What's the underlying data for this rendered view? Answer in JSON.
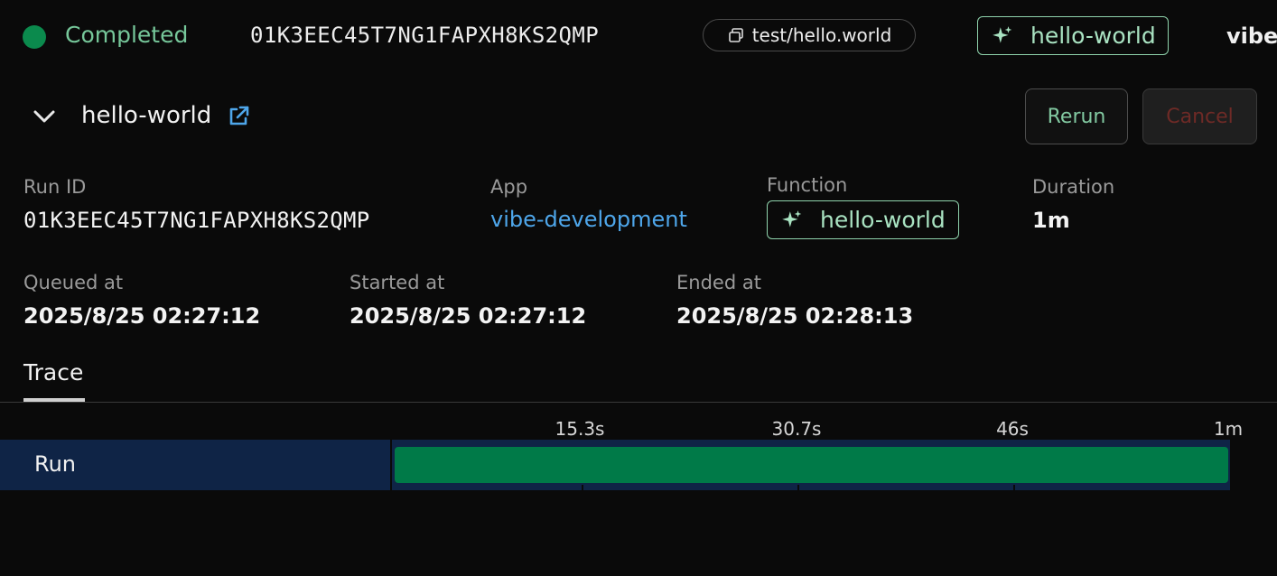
{
  "top": {
    "status": "Completed",
    "run_id": "01K3EEC45T7NG1FAPXH8KS2QMP",
    "event_name": "test/hello.world",
    "function_name": "hello-world",
    "app_truncated": "vibe"
  },
  "header": {
    "title": "hello-world",
    "rerun_label": "Rerun",
    "cancel_label": "Cancel"
  },
  "meta": {
    "run_id_label": "Run ID",
    "run_id": "01K3EEC45T7NG1FAPXH8KS2QMP",
    "app_label": "App",
    "app": "vibe-development",
    "function_label": "Function",
    "function": "hello-world",
    "duration_label": "Duration",
    "duration": "1m",
    "queued_label": "Queued at",
    "queued": "2025/8/25 02:27:12",
    "started_label": "Started at",
    "started": "2025/8/25 02:27:12",
    "ended_label": "Ended at",
    "ended": "2025/8/25 02:28:13"
  },
  "tabs": {
    "trace": "Trace"
  },
  "timeline": {
    "ticks": [
      "15.3s",
      "30.7s",
      "46s",
      "1m"
    ],
    "row_label": "Run",
    "run_progress": 1.0
  },
  "colors": {
    "status_green": "#0b8a4d",
    "run_bar": "#007a48",
    "track_bg": "#0f2446",
    "link": "#4ea6ea"
  }
}
